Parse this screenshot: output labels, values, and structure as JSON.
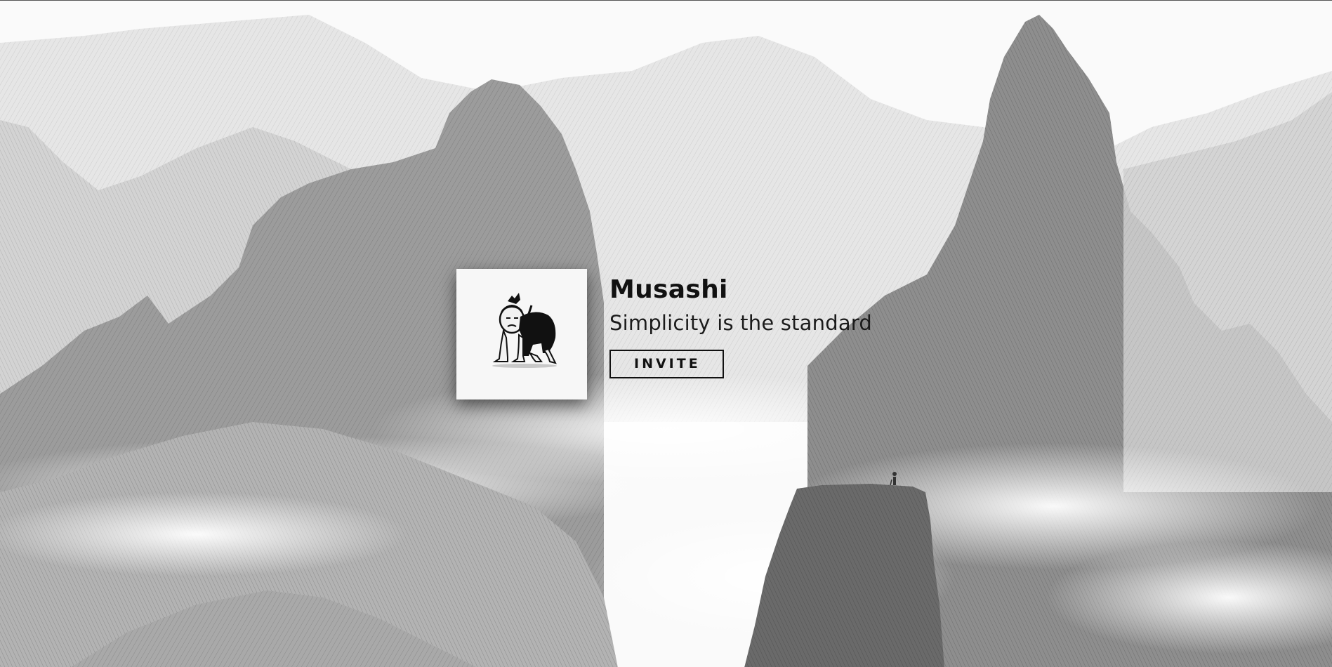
{
  "profile": {
    "name": "Musashi",
    "tagline": "Simplicity is the standard",
    "invite_label": "INVITE",
    "avatar_icon": "samurai-avatar-icon"
  },
  "background": {
    "description_icon": "ink-mountain-landscape",
    "colors": {
      "sky": "#fafafa",
      "far_mountain": "#e3e3e3",
      "mid_mountain": "#b8b8b8",
      "near_mountain": "#7a7a7a",
      "dark_rock": "#5e5e5e"
    }
  }
}
